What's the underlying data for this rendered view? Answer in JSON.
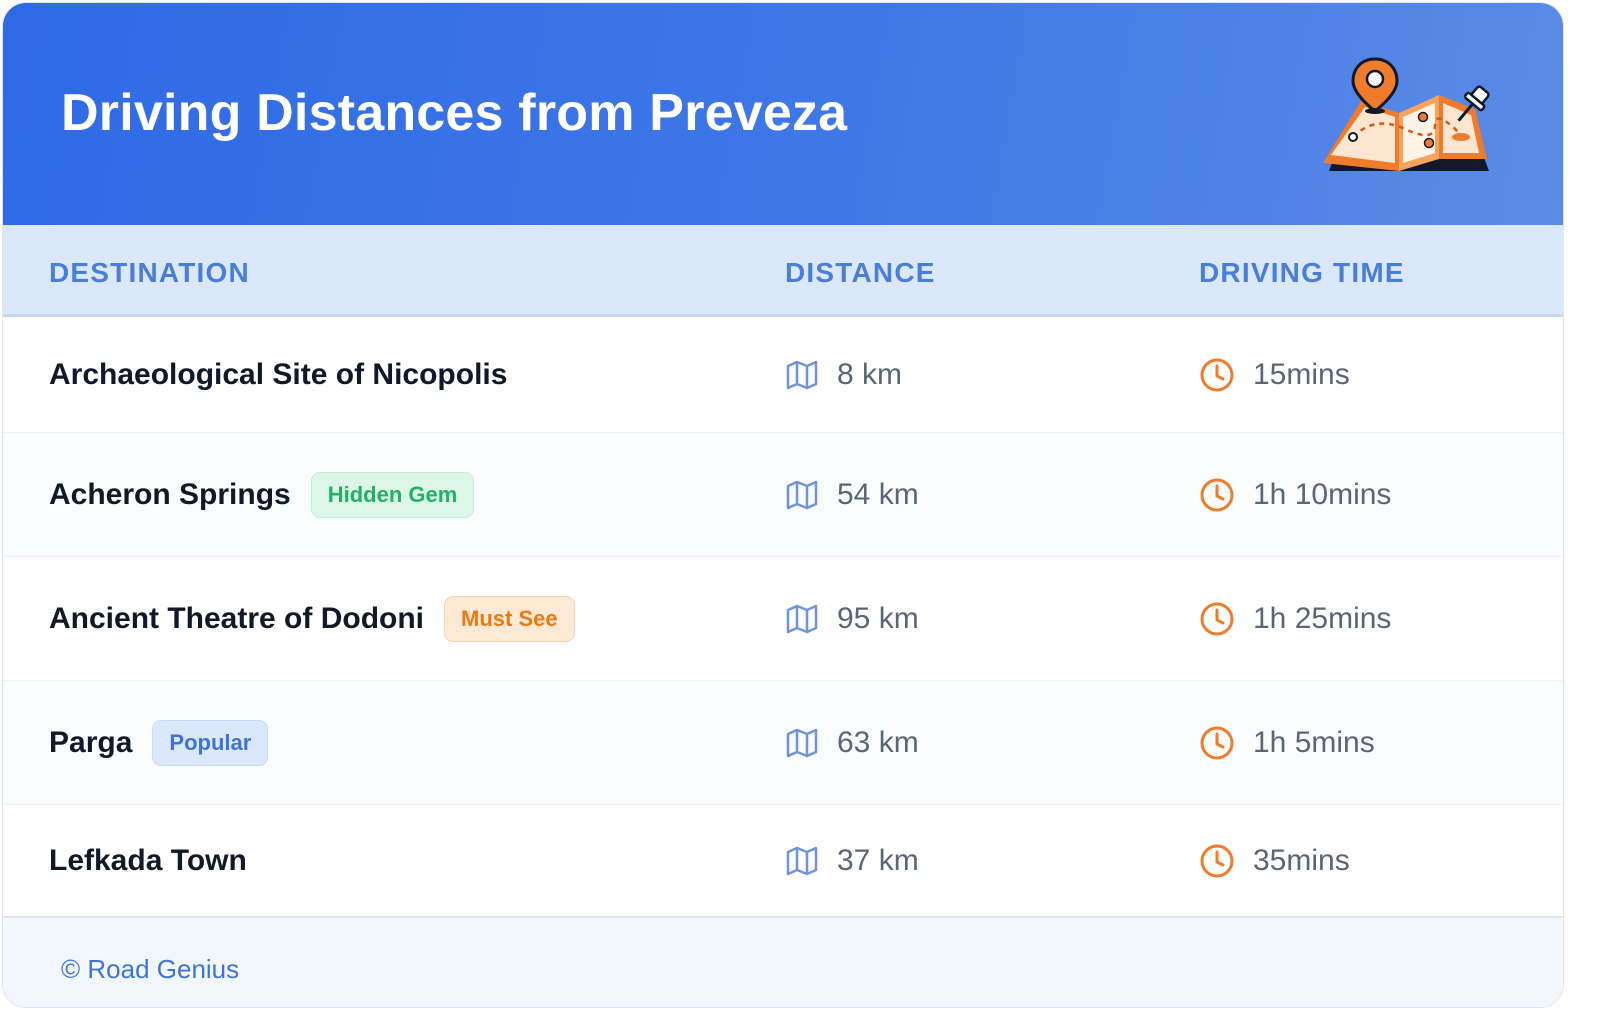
{
  "header": {
    "title": "Driving Distances from Preveza",
    "illustration_icon": "map-with-pin-icon"
  },
  "columns": {
    "destination": "DESTINATION",
    "distance": "DISTANCE",
    "driving_time": "DRIVING TIME"
  },
  "rows": [
    {
      "destination": "Archaeological Site of Nicopolis",
      "badge": "",
      "badge_color": "",
      "distance": "8 km",
      "time": "15mins"
    },
    {
      "destination": "Acheron Springs",
      "badge": "Hidden Gem",
      "badge_color": "green",
      "distance": "54 km",
      "time": "1h 10mins"
    },
    {
      "destination": "Ancient Theatre of Dodoni",
      "badge": "Must See",
      "badge_color": "orange",
      "distance": "95 km",
      "time": "1h 25mins"
    },
    {
      "destination": "Parga",
      "badge": "Popular",
      "badge_color": "blue",
      "distance": "63 km",
      "time": "1h 5mins"
    },
    {
      "destination": "Lefkada Town",
      "badge": "",
      "badge_color": "",
      "distance": "37 km",
      "time": "35mins"
    }
  ],
  "icons": {
    "distance": "map-icon",
    "time": "clock-icon"
  },
  "footer": {
    "text": "© Road Genius"
  },
  "colors": {
    "header_gradient_start": "#2f6ae6",
    "header_gradient_end": "#5b8be6",
    "column_header_bg": "#dbe8fc",
    "column_header_text": "#4a7fd9",
    "accent_orange": "#ef7b2c",
    "map_icon_color": "#6f93dc"
  }
}
